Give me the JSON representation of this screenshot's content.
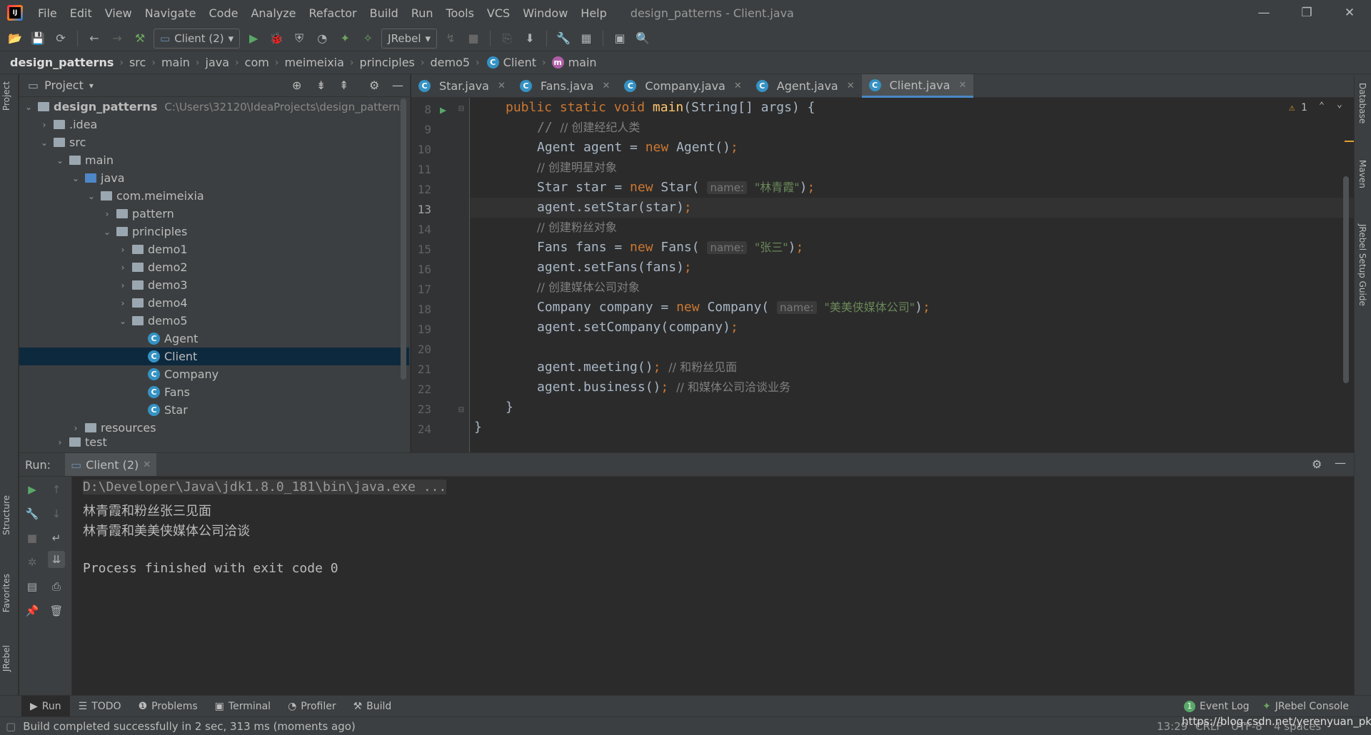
{
  "menu": [
    "File",
    "Edit",
    "View",
    "Navigate",
    "Code",
    "Analyze",
    "Refactor",
    "Build",
    "Run",
    "Tools",
    "VCS",
    "Window",
    "Help"
  ],
  "window_title": "design_patterns - Client.java",
  "toolbar": {
    "run_config": "Client (2)",
    "jrebel": "JRebel"
  },
  "breadcrumb": [
    "design_patterns",
    "src",
    "main",
    "java",
    "com",
    "meimeixia",
    "principles",
    "demo5",
    "Client",
    "main"
  ],
  "project": {
    "title": "Project",
    "tree": [
      {
        "label": "design_patterns",
        "hint": "C:\\Users\\32120\\IdeaProjects\\design_patterns"
      },
      {
        "label": ".idea"
      },
      {
        "label": "src"
      },
      {
        "label": "main"
      },
      {
        "label": "java"
      },
      {
        "label": "com.meimeixia"
      },
      {
        "label": "pattern"
      },
      {
        "label": "principles"
      },
      {
        "label": "demo1"
      },
      {
        "label": "demo2"
      },
      {
        "label": "demo3"
      },
      {
        "label": "demo4"
      },
      {
        "label": "demo5"
      },
      {
        "label": "Agent"
      },
      {
        "label": "Client"
      },
      {
        "label": "Company"
      },
      {
        "label": "Fans"
      },
      {
        "label": "Star"
      },
      {
        "label": "resources"
      },
      {
        "label": "test"
      }
    ]
  },
  "tabs": [
    "Star.java",
    "Fans.java",
    "Company.java",
    "Agent.java",
    "Client.java"
  ],
  "editor": {
    "warning_count": "1",
    "line_numbers": [
      "8",
      "9",
      "10",
      "11",
      "12",
      "13",
      "14",
      "15",
      "16",
      "17",
      "18",
      "19",
      "20",
      "21",
      "22",
      "23",
      "24"
    ],
    "hint_name": "name:",
    "strings": {
      "star": "\"林青霞\"",
      "fans": "\"张三\"",
      "company": "\"美美侠媒体公司\""
    },
    "comments": {
      "agent": "// 创建经纪人类",
      "star": "// 创建明星对象",
      "fans": "// 创建粉丝对象",
      "company": "// 创建媒体公司对象",
      "meeting": "// 和粉丝见面",
      "business": "// 和媒体公司洽谈业务"
    }
  },
  "run": {
    "label": "Run:",
    "tab": "Client (2)",
    "console": [
      "D:\\Developer\\Java\\jdk1.8.0_181\\bin\\java.exe ...",
      "林青霞和粉丝张三见面",
      "林青霞和美美侠媒体公司洽谈",
      "",
      "Process finished with exit code 0"
    ]
  },
  "left_stripe": [
    "Project",
    "Structure",
    "Favorites",
    "JRebel"
  ],
  "right_stripe": [
    "Database",
    "Maven",
    "JRebel Setup Guide"
  ],
  "bottom_tabs": [
    "Run",
    "TODO",
    "Problems",
    "Terminal",
    "Profiler",
    "Build"
  ],
  "bottom_right": {
    "event_log": "Event Log",
    "event_count": "1",
    "jrebel_console": "JRebel Console"
  },
  "status": {
    "message": "Build completed successfully in 2 sec, 313 ms (moments ago)",
    "position": "13:29",
    "line_sep": "CRLF",
    "encoding": "UTF-8",
    "indent": "4 spaces",
    "watermark": "https://blog.csdn.net/yerenyuan_pku"
  }
}
